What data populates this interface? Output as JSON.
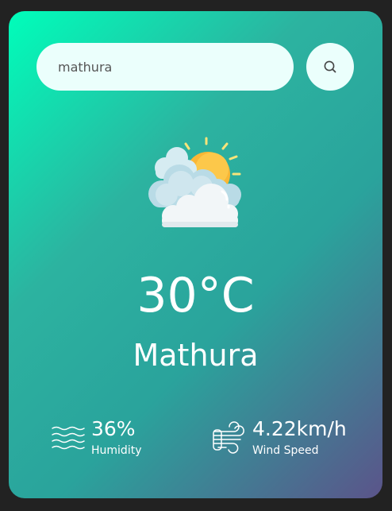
{
  "search": {
    "value": "mathura",
    "placeholder": ""
  },
  "search_button": {
    "icon": "search-icon"
  },
  "weather": {
    "icon": "partly-cloudy-sun-icon",
    "temperature": "30°C",
    "city": "Mathura"
  },
  "details": {
    "humidity": {
      "icon": "humidity-waves-icon",
      "value": "36%",
      "label": "Humidity"
    },
    "wind": {
      "icon": "wind-icon",
      "value": "4.22km/h",
      "label": "Wind Speed"
    }
  },
  "colors": {
    "background": "#222222",
    "gradient_start": "#00feba",
    "gradient_end": "#5b548a",
    "input_bg": "#ebfffc",
    "text": "#ffffff"
  }
}
